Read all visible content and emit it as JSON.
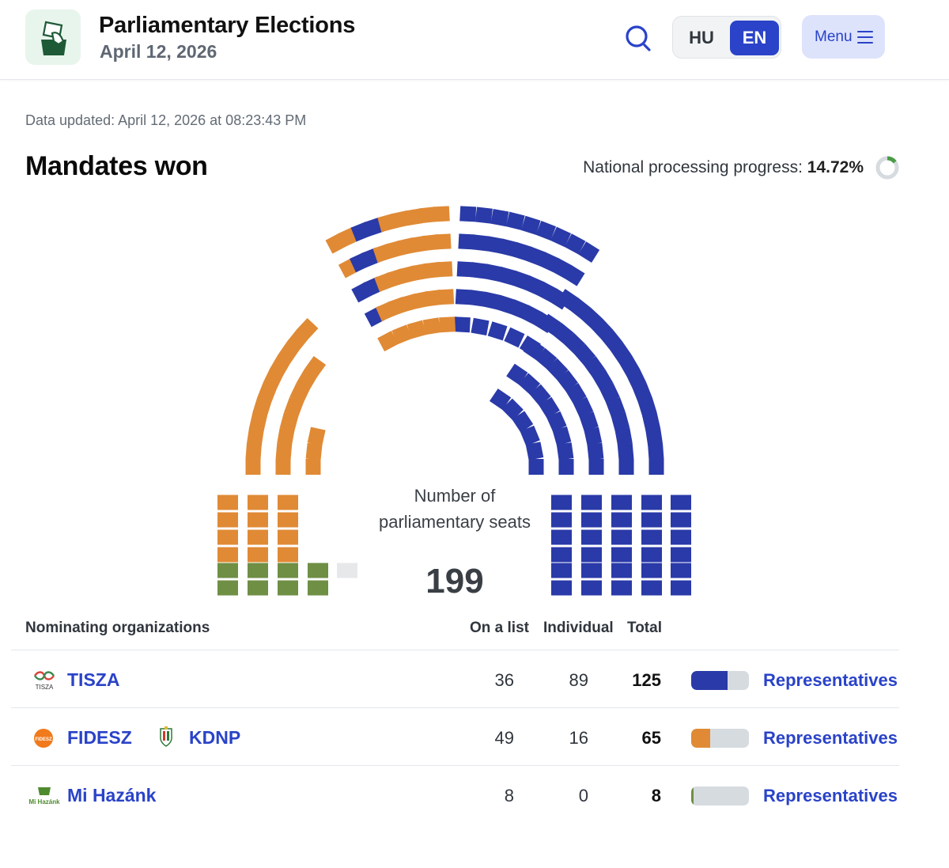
{
  "header": {
    "title": "Parliamentary Elections",
    "date": "April 12, 2026",
    "lang_hu": "HU",
    "lang_en": "EN",
    "active_lang": "EN",
    "menu_label": "Menu"
  },
  "updated_text": "Data updated: April 12, 2026 at 08:23:43 PM",
  "section_title": "Mandates won",
  "progress": {
    "label": "National processing progress: ",
    "value": "14.72%",
    "fraction": 0.1472
  },
  "colors": {
    "tisza": "#2a3aa8",
    "fidesz": "#e08a35",
    "mihazank": "#6f8f45",
    "empty": "#e6e8ea",
    "accent": "#2a43c8"
  },
  "chart_data": {
    "type": "parliament",
    "caption": "Number of parliamentary seats",
    "total_seats": 199,
    "seats": [
      {
        "party": "TISZA",
        "seats": 125
      },
      {
        "party": "FIDESZ – KDNP",
        "seats": 65
      },
      {
        "party": "Mi Hazánk",
        "seats": 8
      },
      {
        "party": "unassigned",
        "seats": 1
      }
    ]
  },
  "seat_chart": {
    "caption": "Number of parliamentary seats",
    "total": "199"
  },
  "table": {
    "headers": {
      "org": "Nominating organizations",
      "list": "On a list",
      "individual": "Individual",
      "total": "Total"
    },
    "rows": [
      {
        "name": "TISZA",
        "logo_text": "TISZA",
        "list": "36",
        "individual": "89",
        "total": "125",
        "share": 0.628,
        "link": "Representatives"
      },
      {
        "name": "FIDESZ",
        "partner": "KDNP",
        "logo_text": "FIDESZ",
        "list": "49",
        "individual": "16",
        "total": "65",
        "share": 0.327,
        "link": "Representatives"
      },
      {
        "name": "Mi Hazánk",
        "logo_text": "Mi Hazánk",
        "list": "8",
        "individual": "0",
        "total": "8",
        "share": 0.04,
        "link": "Representatives"
      }
    ]
  }
}
